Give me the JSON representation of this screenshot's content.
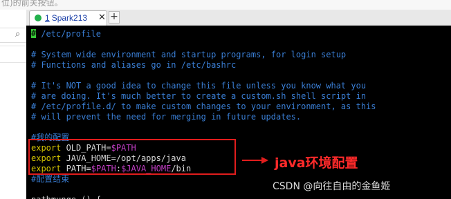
{
  "page": {
    "top_clipped_text": "位)的前关按钮。"
  },
  "left_panel": {
    "search_icon": "search-icon"
  },
  "tabbar": {
    "tab": {
      "number": "1",
      "title": "Spark213",
      "status_color": "#22b14c",
      "close_glyph": "✕"
    },
    "add_glyph": "+"
  },
  "terminal": {
    "lines": [
      [
        {
          "t": "#",
          "k": "cursor"
        },
        {
          "t": " /etc/profile",
          "k": "cmt"
        }
      ],
      [],
      [
        {
          "t": "# System wide environment and startup programs, for login setup",
          "k": "cmt"
        }
      ],
      [
        {
          "t": "# Functions and aliases go in /etc/bashrc",
          "k": "cmt"
        }
      ],
      [],
      [
        {
          "t": "# It's NOT a good idea to change this file unless you know what you",
          "k": "cmt"
        }
      ],
      [
        {
          "t": "# are doing. It's much better to create a custom.sh shell script in",
          "k": "cmt"
        }
      ],
      [
        {
          "t": "# /etc/profile.d/ to make custom changes to your environment, as this",
          "k": "cmt"
        }
      ],
      [
        {
          "t": "# will prevent the need for merging in future updates.",
          "k": "cmt"
        }
      ],
      [],
      [
        {
          "t": "#我的配置",
          "k": "cmt"
        }
      ],
      [
        {
          "t": "export",
          "k": "kw"
        },
        {
          "t": " OLD_PATH=",
          "k": "txt"
        },
        {
          "t": "$PATH",
          "k": "var"
        }
      ],
      [
        {
          "t": "export",
          "k": "kw"
        },
        {
          "t": " JAVA_HOME=/opt/apps/java",
          "k": "txt"
        }
      ],
      [
        {
          "t": "export",
          "k": "kw"
        },
        {
          "t": " PATH=",
          "k": "txt"
        },
        {
          "t": "$PATH",
          "k": "var"
        },
        {
          "t": ":",
          "k": "txt"
        },
        {
          "t": "$JAVA_HOME",
          "k": "var"
        },
        {
          "t": "/bin",
          "k": "txt"
        }
      ],
      [
        {
          "t": "#配置结束",
          "k": "cmt"
        }
      ],
      [],
      [
        {
          "t": "pathmunge () {",
          "k": "txt"
        }
      ]
    ],
    "colors": {
      "comment": "#3a7fd6",
      "keyword": "#d4c400",
      "variable": "#c23ec4",
      "text": "#d8d8d8",
      "cursor": "#37c837"
    }
  },
  "annotation": {
    "text": "java环境配置",
    "color": "#ff2a2a"
  },
  "watermark": "CSDN @向往自由的金鱼姬"
}
